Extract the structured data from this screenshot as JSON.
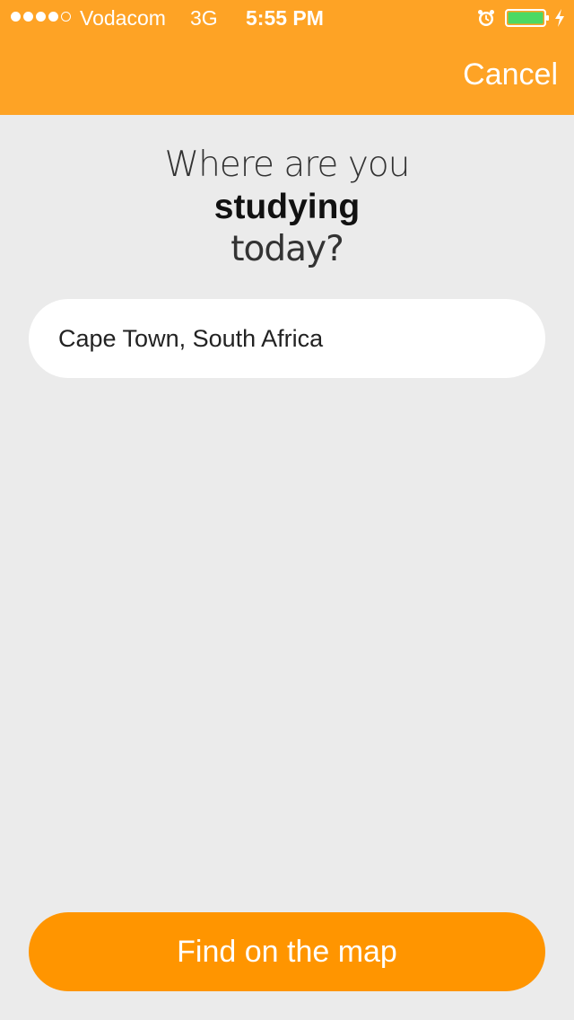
{
  "status_bar": {
    "signal_dots_filled": 4,
    "signal_dots_total": 5,
    "carrier": "Vodacom",
    "network": "3G",
    "time": "5:55 PM",
    "icons": [
      "alarm-icon",
      "battery-icon",
      "charging-icon"
    ]
  },
  "header": {
    "cancel_label": "Cancel"
  },
  "question": {
    "line1": "Where are you",
    "line2": "studying",
    "line3": "today?"
  },
  "location": {
    "value": "Cape Town, South Africa"
  },
  "actions": {
    "find_label": "Find on the map"
  },
  "colors": {
    "header_bg": "#FEA325",
    "page_bg": "#EBEBEB",
    "button_bg": "#FF9500",
    "battery_fill": "#4CD964"
  }
}
